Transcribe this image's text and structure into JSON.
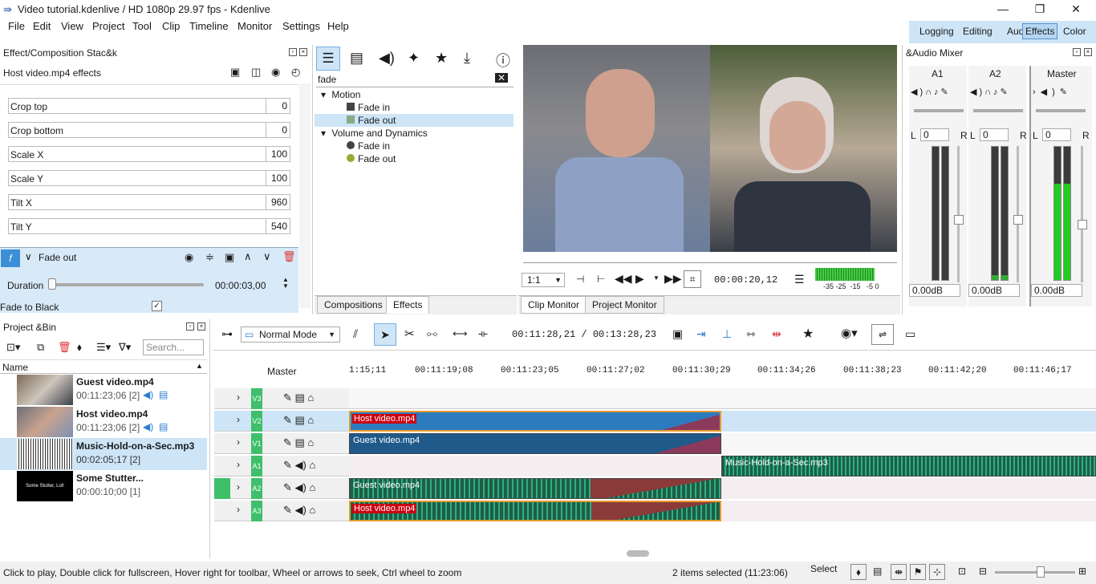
{
  "window": {
    "title": "Video tutorial.kdenlive / HD 1080p 29.97 fps - Kdenlive",
    "minimize": "—",
    "maximize": "❐",
    "close": "✕"
  },
  "menu": [
    "File",
    "Edit",
    "View",
    "Project",
    "Tool",
    "Clip",
    "Timeline",
    "Monitor",
    "Settings",
    "Help"
  ],
  "layouts": [
    "Logging",
    "Editing",
    "Audio",
    "Effects",
    "Color"
  ],
  "effect_stack": {
    "title": "Effect/Composition Stac&k",
    "clip": "Host video.mp4 effects",
    "params": [
      {
        "label": "Crop top",
        "value": "0"
      },
      {
        "label": "Crop bottom",
        "value": "0"
      },
      {
        "label": "Scale X",
        "value": "100"
      },
      {
        "label": "Scale Y",
        "value": "100"
      },
      {
        "label": "Tilt X",
        "value": "960"
      },
      {
        "label": "Tilt Y",
        "value": "540"
      }
    ],
    "effect_name": "Fade out",
    "duration_label": "Duration",
    "duration_value": "00:00:03,00",
    "fade_black": "Fade to Black"
  },
  "effects": {
    "search": "fade",
    "groups": [
      {
        "name": "Motion",
        "items": [
          "Fade in",
          "Fade out"
        ]
      },
      {
        "name": "Volume and Dynamics",
        "items": [
          "Fade in",
          "Fade out"
        ]
      }
    ],
    "tab1": "Compositions",
    "tab2": "Effects"
  },
  "monitor": {
    "zoom": "1:1",
    "timecode": "00:00:20,12",
    "tab1": "Clip Monitor",
    "tab2": "Project Monitor",
    "vu_labels": "-35 -25  -15   -5 0"
  },
  "mixer": {
    "title": "&Audio Mixer",
    "channels": [
      {
        "name": "A1",
        "pan": "0",
        "db": "0.00dB"
      },
      {
        "name": "A2",
        "pan": "0",
        "db": "0.00dB"
      },
      {
        "name": "Master",
        "pan": "0",
        "db": "0.00dB"
      }
    ],
    "scale": [
      "0",
      "-5",
      "-10",
      "-15",
      "-20",
      "-25",
      "-30",
      "-35",
      "-40",
      "-45",
      "-50"
    ]
  },
  "bin": {
    "title": "Project &Bin",
    "search": "Search...",
    "col": "Name",
    "items": [
      {
        "name": "Guest video.mp4",
        "meta": "00:11:23;06 [2]"
      },
      {
        "name": "Host video.mp4",
        "meta": "00:11:23;06 [2]"
      },
      {
        "name": "Music-Hold-on-a-Sec.mp3",
        "meta": "00:02:05;17 [2]"
      },
      {
        "name": "Some Stutter...",
        "meta": "00:00:10;00 [1]"
      }
    ],
    "thumb_text": "Some Stutter, Lol!"
  },
  "timeline": {
    "mode": "Normal Mode",
    "position": "00:11:28,21 / 00:13:28,23",
    "master": "Master",
    "ruler": [
      "1:15;11",
      "00:11:19;08",
      "00:11:23;05",
      "00:11:27;02",
      "00:11:30;29",
      "00:11:34;26",
      "00:11:38;23",
      "00:11:42;20",
      "00:11:46;17"
    ],
    "tracks": [
      "V3",
      "V2",
      "V1",
      "A1",
      "A2",
      "A3"
    ],
    "clips": {
      "v2": "Host video.mp4",
      "v1": "Guest video.mp4",
      "a1": "Music-Hold-on-a-Sec.mp3",
      "a2": "Guest video.mp4",
      "a3": "Host video.mp4"
    }
  },
  "status": {
    "help": "Click to play, Double click for fullscreen, Hover right for toolbar, Wheel or arrows to seek, Ctrl wheel to zoom",
    "selection": "2 items selected (11:23:06)",
    "tool": "Select"
  }
}
